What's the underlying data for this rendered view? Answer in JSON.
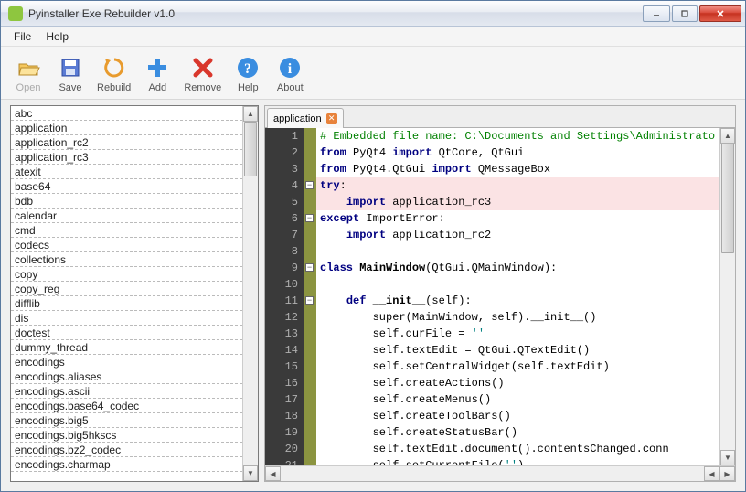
{
  "window": {
    "title": "Pyinstaller Exe Rebuilder v1.0"
  },
  "menubar": {
    "items": [
      "File",
      "Help"
    ]
  },
  "toolbar": {
    "buttons": [
      {
        "id": "open",
        "label": "Open",
        "disabled": true
      },
      {
        "id": "save",
        "label": "Save",
        "disabled": false
      },
      {
        "id": "rebuild",
        "label": "Rebuild",
        "disabled": false
      },
      {
        "id": "add",
        "label": "Add",
        "disabled": false
      },
      {
        "id": "remove",
        "label": "Remove",
        "disabled": false
      },
      {
        "id": "help",
        "label": "Help",
        "disabled": false
      },
      {
        "id": "about",
        "label": "About",
        "disabled": false
      }
    ]
  },
  "modules": [
    "abc",
    "application",
    "application_rc2",
    "application_rc3",
    "atexit",
    "base64",
    "bdb",
    "calendar",
    "cmd",
    "codecs",
    "collections",
    "copy",
    "copy_reg",
    "difflib",
    "dis",
    "doctest",
    "dummy_thread",
    "encodings",
    "encodings.aliases",
    "encodings.ascii",
    "encodings.base64_codec",
    "encodings.big5",
    "encodings.big5hkscs",
    "encodings.bz2_codec",
    "encodings.charmap"
  ],
  "editor": {
    "tab": {
      "label": "application"
    },
    "lines": [
      {
        "n": 1,
        "cls": "",
        "html": "<span class='c-comment'># Embedded file name: C:\\Documents and Settings\\Administrato</span>"
      },
      {
        "n": 2,
        "cls": "",
        "html": "<span class='c-kw'>from</span> PyQt4 <span class='c-kw'>import</span> QtCore, QtGui"
      },
      {
        "n": 3,
        "cls": "",
        "html": "<span class='c-kw'>from</span> PyQt4.QtGui <span class='c-kw'>import</span> QMessageBox"
      },
      {
        "n": 4,
        "cls": "hl-pink",
        "fold": true,
        "html": "<span class='c-kw'>try</span>:"
      },
      {
        "n": 5,
        "cls": "hl-pink",
        "html": "    <span class='c-kw'>import</span> application_rc3"
      },
      {
        "n": 6,
        "cls": "",
        "fold": true,
        "html": "<span class='c-kw'>except</span> ImportError:"
      },
      {
        "n": 7,
        "cls": "",
        "html": "    <span class='c-kw'>import</span> application_rc2"
      },
      {
        "n": 8,
        "cls": "",
        "html": ""
      },
      {
        "n": 9,
        "cls": "",
        "fold": true,
        "html": "<span class='c-kw'>class</span> <span class='c-cls'>MainWindow</span>(QtGui.QMainWindow):"
      },
      {
        "n": 10,
        "cls": "",
        "html": ""
      },
      {
        "n": 11,
        "cls": "",
        "fold": true,
        "html": "    <span class='c-kw'>def</span> <span class='c-cls'>__init__</span>(self):"
      },
      {
        "n": 12,
        "cls": "",
        "html": "        super(MainWindow, self).__init__()"
      },
      {
        "n": 13,
        "cls": "",
        "html": "        self.curFile = <span class='c-str'>''</span>"
      },
      {
        "n": 14,
        "cls": "",
        "html": "        self.textEdit = QtGui.QTextEdit()"
      },
      {
        "n": 15,
        "cls": "",
        "html": "        self.setCentralWidget(self.textEdit)"
      },
      {
        "n": 16,
        "cls": "",
        "html": "        self.createActions()"
      },
      {
        "n": 17,
        "cls": "",
        "html": "        self.createMenus()"
      },
      {
        "n": 18,
        "cls": "",
        "html": "        self.createToolBars()"
      },
      {
        "n": 19,
        "cls": "",
        "html": "        self.createStatusBar()"
      },
      {
        "n": 20,
        "cls": "",
        "html": "        self.textEdit.document().contentsChanged.conn"
      },
      {
        "n": 21,
        "cls": "",
        "html": "        self.setCurrentFile(<span class='c-str'>''</span>)"
      }
    ]
  }
}
